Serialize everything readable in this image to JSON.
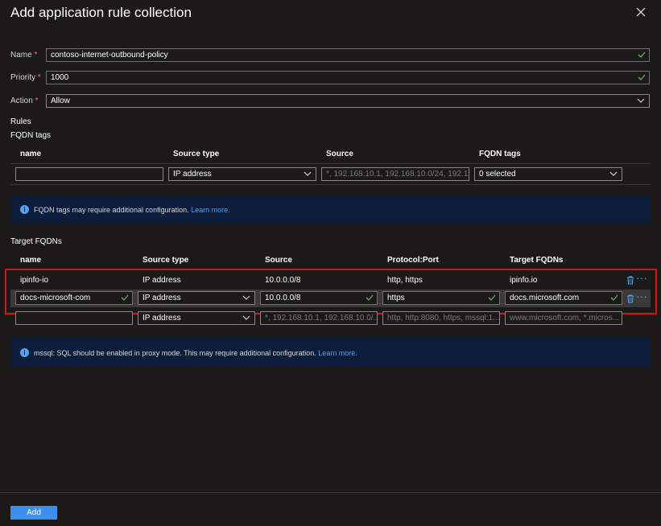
{
  "panel": {
    "title": "Add application rule collection",
    "close_icon": "close-icon"
  },
  "form": {
    "name": {
      "label": "Name",
      "required_mark": "*",
      "value": "contoso-internet-outbound-policy"
    },
    "priority": {
      "label": "Priority",
      "required_mark": "*",
      "value": "1000"
    },
    "action": {
      "label": "Action",
      "required_mark": "*",
      "value": "Allow"
    }
  },
  "rules": {
    "heading": "Rules",
    "fqdn_tags": {
      "heading": "FQDN tags",
      "columns": [
        "name",
        "Source type",
        "Source",
        "FQDN tags"
      ],
      "new_row": {
        "name": "",
        "source_type": "IP address",
        "source_placeholder": "*, 192.168.10.1, 192.168.10.0/24, 192.1...",
        "fqdn_tags": "0 selected"
      },
      "info": {
        "text": "FQDN tags may require additional configuration.",
        "link": "Learn more."
      }
    },
    "target_fqdns": {
      "heading": "Target FQDNs",
      "columns": [
        "name",
        "Source type",
        "Source",
        "Protocol:Port",
        "Target FQDNs"
      ],
      "rows": [
        {
          "name": "ipinfo-io",
          "source_type": "IP address",
          "source": "10.0.0.0/8",
          "protocol_port": "http, https",
          "target_fqdns": "ipinfo.io"
        }
      ],
      "editing_row": {
        "name": "docs-microsoft-com",
        "source_type": "IP address",
        "source": "10.0.0.0/8",
        "protocol_port": "https",
        "target_fqdns": "docs.microsoft.com"
      },
      "new_row": {
        "name": "",
        "source_type": "IP address",
        "source_placeholder": "*, 192.168.10.1, 192.168.10.0/...",
        "protocol_placeholder": "http, http:8080, https, mssql:1...",
        "target_placeholder": "www.microsoft.com, *.micros..."
      },
      "info": {
        "text": "mssql: SQL should be enabled in proxy mode. This may require additional configuration.",
        "link": "Learn more."
      }
    }
  },
  "footer": {
    "add_label": "Add"
  },
  "colors": {
    "accent": "#3d8ef0",
    "highlight_border": "#c8191e",
    "check": "#5fb25f",
    "required": "#f1707b"
  }
}
